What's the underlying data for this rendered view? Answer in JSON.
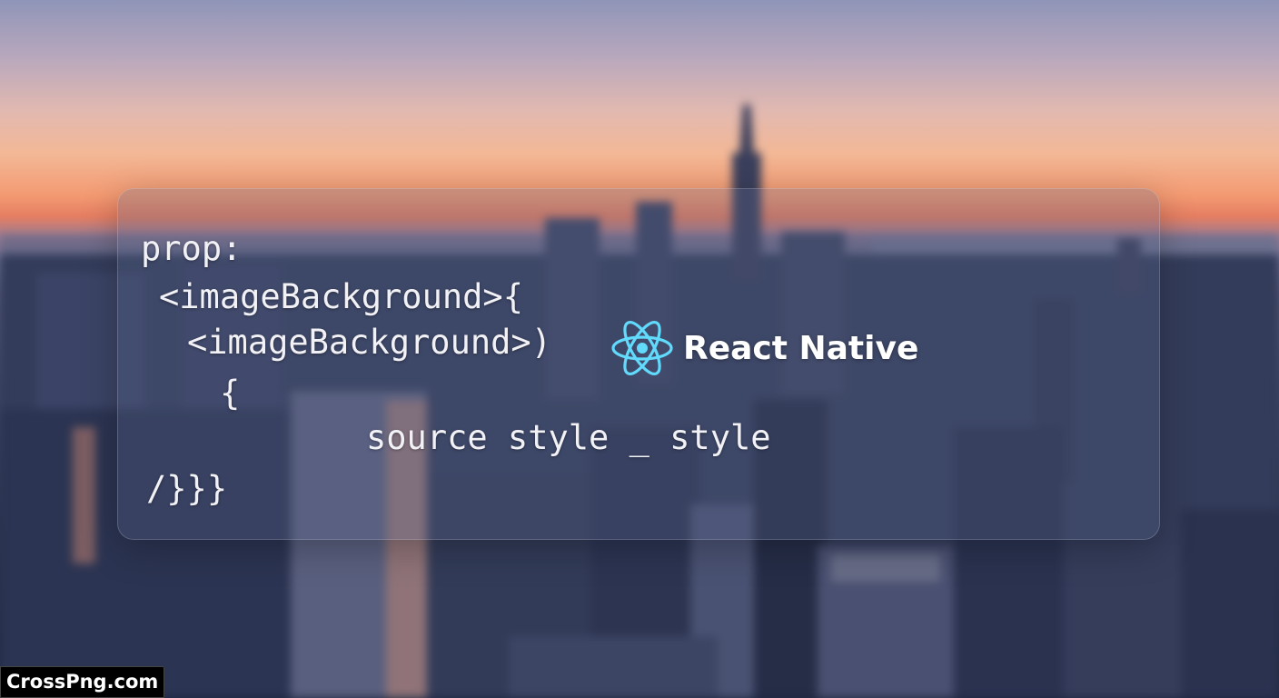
{
  "code": {
    "lines": [
      "prop:",
      "<imageBackground>{",
      "<imageBackground>)",
      "{",
      "source style _ style",
      "/}}}"
    ]
  },
  "brand": {
    "icon": "react-atom-icon",
    "label": "React Native",
    "accent": "#61dafb"
  },
  "watermark": {
    "text": "CrossPng.com"
  }
}
